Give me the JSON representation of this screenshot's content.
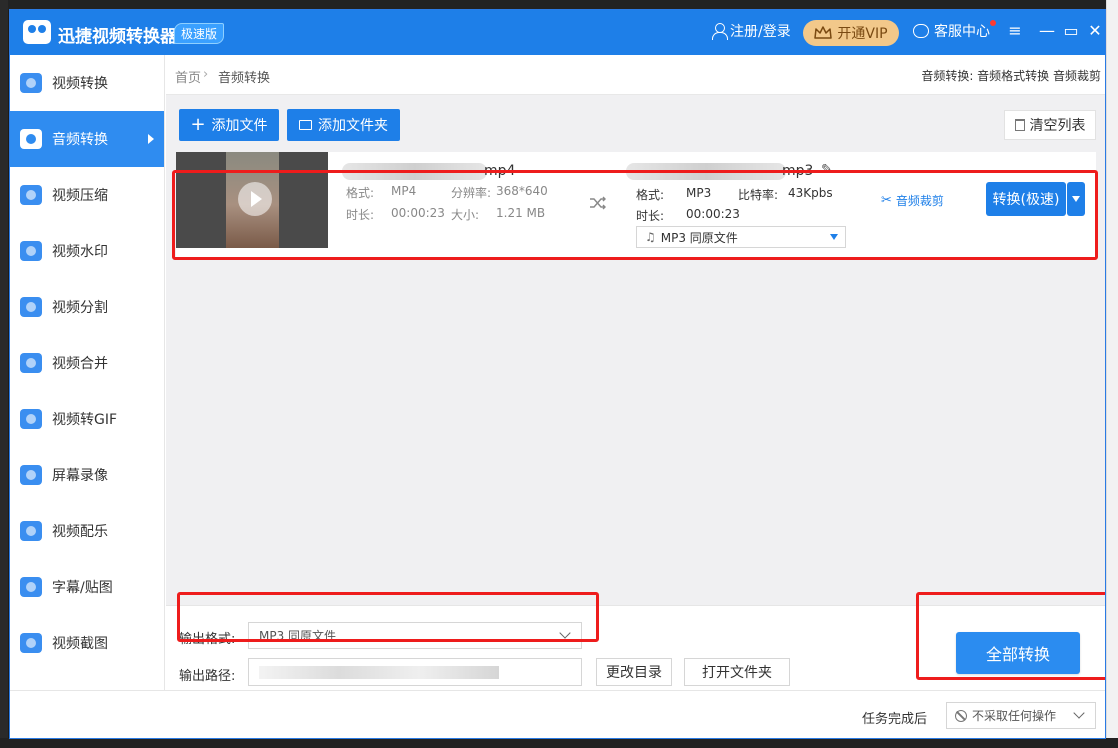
{
  "app": {
    "title": "迅捷视频转换器",
    "edition": "极速版",
    "login": "注册/登录",
    "vip": "开通VIP",
    "service": "客服中心"
  },
  "sidebar": {
    "items": [
      {
        "label": "视频转换"
      },
      {
        "label": "音频转换"
      },
      {
        "label": "视频压缩"
      },
      {
        "label": "视频水印"
      },
      {
        "label": "视频分割"
      },
      {
        "label": "视频合并"
      },
      {
        "label": "视频转GIF"
      },
      {
        "label": "屏幕录像"
      },
      {
        "label": "视频配乐"
      },
      {
        "label": "字幕/贴图"
      },
      {
        "label": "视频截图"
      }
    ],
    "active_index": 1
  },
  "breadcrumb": {
    "home": "首页",
    "separator": "›",
    "current": "音频转换",
    "description": "音频转换: 音频格式转换 音频裁剪"
  },
  "toolbar": {
    "add_file": "添加文件",
    "add_folder": "添加文件夹",
    "clear_list": "清空列表"
  },
  "file": {
    "source": {
      "ext": "mp4",
      "format_label": "格式:",
      "format": "MP4",
      "resolution_label": "分辨率:",
      "resolution": "368*640",
      "duration_label": "时长:",
      "duration": "00:00:23",
      "size_label": "大小:",
      "size": "1.21 MB"
    },
    "target": {
      "ext": "mp3",
      "format_label": "格式:",
      "format": "MP3",
      "bitrate_label": "比特率:",
      "bitrate": "43Kpbs",
      "duration_label": "时长:",
      "duration": "00:00:23",
      "select": "MP3  同原文件"
    },
    "trim": "音频裁剪",
    "convert": "转换(极速)"
  },
  "output": {
    "format_label": "输出格式:",
    "format_value": "MP3  同原文件",
    "path_label": "输出路径:",
    "change_dir": "更改目录",
    "open_folder": "打开文件夹",
    "convert_all": "全部转换"
  },
  "status": {
    "after_label": "任务完成后",
    "after_value": "不采取任何操作"
  },
  "colors": {
    "brand": "#1e7fe8",
    "annotation": "#ee1c1c",
    "vip": "#f2c88a"
  }
}
